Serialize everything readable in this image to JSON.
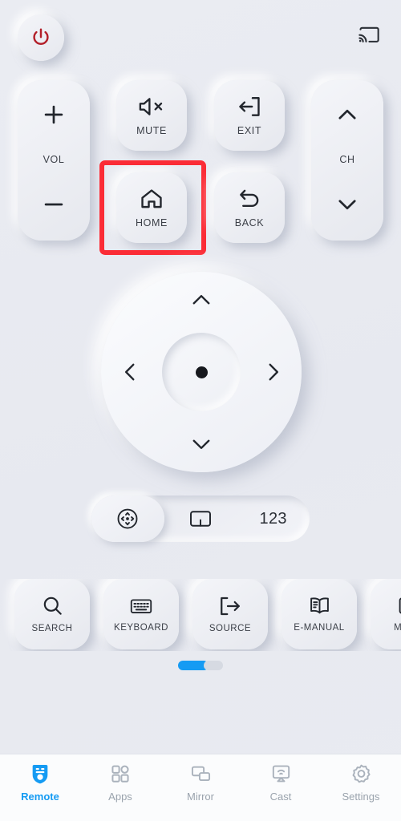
{
  "app": {
    "screen_title": "Remote",
    "background_color": "#e9ebf1",
    "accent_color": "#159bf3",
    "highlight_color": "#fb2c36",
    "power_color": "#b3202a"
  },
  "header": {
    "power_button": {
      "label": "Power",
      "icon": "power-icon"
    },
    "cast_button": {
      "label": "Cast",
      "icon": "cast-screen-icon"
    }
  },
  "controls": {
    "volume_rocker": {
      "label": "VOL",
      "up_icon": "plus-icon",
      "down_icon": "minus-icon",
      "up_label": "Volume Up",
      "down_label": "Volume Down"
    },
    "channel_rocker": {
      "label": "CH",
      "up_icon": "chevron-up-icon",
      "down_icon": "chevron-down-icon",
      "up_label": "Channel Up",
      "down_label": "Channel Down"
    },
    "buttons": [
      {
        "id": "mute",
        "label": "MUTE",
        "icon": "speaker-mute-icon"
      },
      {
        "id": "exit",
        "label": "EXIT",
        "icon": "exit-arrow-icon"
      },
      {
        "id": "home",
        "label": "HOME",
        "icon": "home-icon",
        "highlighted": true
      },
      {
        "id": "back",
        "label": "BACK",
        "icon": "back-arrow-icon"
      }
    ]
  },
  "dpad": {
    "up_icon": "chevron-up-icon",
    "down_icon": "chevron-down-icon",
    "left_icon": "chevron-left-icon",
    "right_icon": "chevron-right-icon",
    "ok_icon": "dot-icon",
    "ok_label": "OK"
  },
  "mode_bar": {
    "selected": "dpad",
    "segments": [
      {
        "id": "dpad",
        "icon": "dpad-circle-icon",
        "label": "D-Pad",
        "text": ""
      },
      {
        "id": "touch",
        "icon": "touchpad-icon",
        "label": "Touchpad",
        "text": ""
      },
      {
        "id": "numeric",
        "icon": "",
        "label": "Numbers",
        "text": "123"
      }
    ]
  },
  "shortcuts": {
    "items": [
      {
        "label": "SEARCH",
        "icon": "search-icon"
      },
      {
        "label": "KEYBOARD",
        "icon": "keyboard-icon"
      },
      {
        "label": "SOURCE",
        "icon": "source-input-icon"
      },
      {
        "label": "E-MANUAL",
        "icon": "book-icon"
      },
      {
        "label": "MENU",
        "icon": "list-menu-icon"
      }
    ],
    "pages": {
      "total": 2,
      "current": 1
    }
  },
  "bottom_nav": {
    "active": "Remote",
    "items": [
      {
        "label": "Remote",
        "icon": "remote-icon"
      },
      {
        "label": "Apps",
        "icon": "grid-apps-icon"
      },
      {
        "label": "Mirror",
        "icon": "screen-mirror-icon"
      },
      {
        "label": "Cast",
        "icon": "cast-icon"
      },
      {
        "label": "Settings",
        "icon": "gear-icon"
      }
    ]
  }
}
